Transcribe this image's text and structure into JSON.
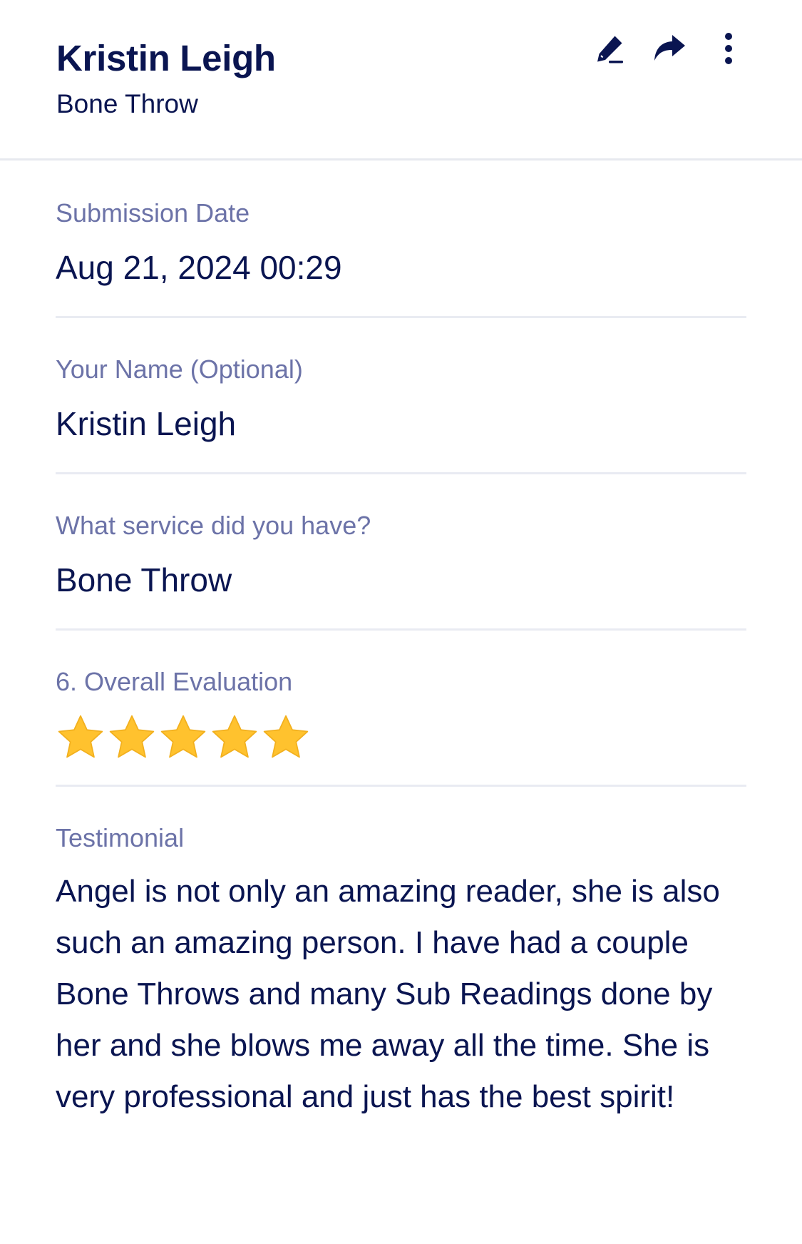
{
  "header": {
    "title": "Kristin Leigh",
    "subtitle": "Bone Throw",
    "actions": [
      {
        "icon": "pencil-icon"
      },
      {
        "icon": "share-arrow-icon"
      },
      {
        "icon": "more-vertical-icon"
      }
    ]
  },
  "fields": {
    "submission_date": {
      "label": "Submission Date",
      "value": "Aug 21, 2024 00:29"
    },
    "your_name": {
      "label": "Your Name (Optional)",
      "value": "Kristin Leigh"
    },
    "service": {
      "label": "What service did you have?",
      "value": "Bone Throw"
    },
    "overall_evaluation": {
      "label": "6. Overall Evaluation",
      "rating": 5,
      "max_rating": 5
    },
    "testimonial": {
      "label": "Testimonial",
      "value": "Angel is not only an amazing reader, she is also such an amazing person. I have had a couple Bone Throws and many Sub Readings done by her and she blows me away all the time. She is very professional and just has the best spirit!"
    }
  },
  "colors": {
    "text_primary": "#0a1551",
    "label": "#6c73a8",
    "divider": "#e9ebf2",
    "star_fill": "#ffc22e"
  }
}
